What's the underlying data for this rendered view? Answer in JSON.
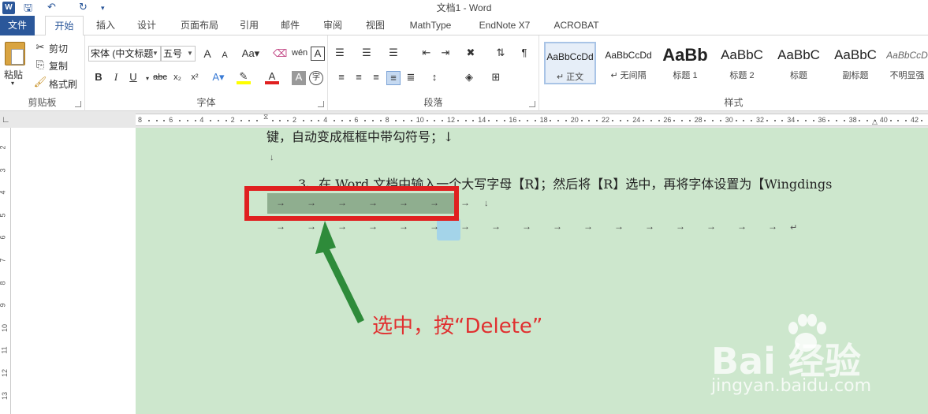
{
  "window": {
    "title": "文档1 - Word",
    "app_icon": "W"
  },
  "quick_access": {
    "save": "save-icon",
    "undo": "undo-icon",
    "redo": "redo-icon",
    "customize": "customize-icon"
  },
  "tabs": [
    "文件",
    "开始",
    "插入",
    "设计",
    "页面布局",
    "引用",
    "邮件",
    "审阅",
    "视图",
    "MathType",
    "EndNote X7",
    "ACROBAT"
  ],
  "active_tab": "开始",
  "clipboard": {
    "paste": "粘贴",
    "cut": "剪切",
    "copy": "复制",
    "format_painter": "格式刷",
    "group": "剪贴板"
  },
  "font": {
    "name": "宋体 (中文标题",
    "size": "五号",
    "group": "字体",
    "bold": "B",
    "italic": "I",
    "underline": "U",
    "strike": "abc",
    "sub": "x₂",
    "sup": "x²",
    "highlight_color": "#ffff00",
    "font_color": "#e02020"
  },
  "paragraph": {
    "group": "段落"
  },
  "styles": {
    "group": "样式",
    "items": [
      {
        "sample": "AaBbCcDd",
        "name": "↵ 正文"
      },
      {
        "sample": "AaBbCcDd",
        "name": "↵ 无间隔"
      },
      {
        "sample": "AaBb",
        "name": "标题 1"
      },
      {
        "sample": "AaBbC",
        "name": "标题 2"
      },
      {
        "sample": "AaBbC",
        "name": "标题"
      },
      {
        "sample": "AaBbC",
        "name": "副标题"
      },
      {
        "sample": "AaBbCcD",
        "name": "不明显强"
      }
    ]
  },
  "ruler": {
    "ticks": [
      "8",
      "6",
      "4",
      "2",
      "",
      "2",
      "4",
      "6",
      "8",
      "10",
      "12",
      "14",
      "16",
      "18",
      "20",
      "22",
      "24",
      "26",
      "28",
      "30",
      "32",
      "34",
      "36",
      "38",
      "40",
      "42"
    ],
    "vticks": [
      "2",
      "3",
      "4",
      "5",
      "6",
      "7",
      "8",
      "9",
      "10",
      "11",
      "12",
      "13"
    ]
  },
  "document": {
    "line1": "键，自动变成框框中带勾符号；↓",
    "line2": "↓",
    "line3": "3、在 Word 文档中输入一个大写字母【R】；然后将【R】选中，再将字体设置为【Wingdings",
    "tab_arrow": "→",
    "para_mark": "↓",
    "line_end": "↵"
  },
  "annotation": "选中，按“Delete”",
  "watermark": {
    "main": "Bai 经验",
    "sub": "jingyan.baidu.com"
  },
  "colors": {
    "page_bg": "#cde7cd",
    "accent": "#2b579a",
    "annotation": "#e03030",
    "highlight_box": "#e02020"
  }
}
